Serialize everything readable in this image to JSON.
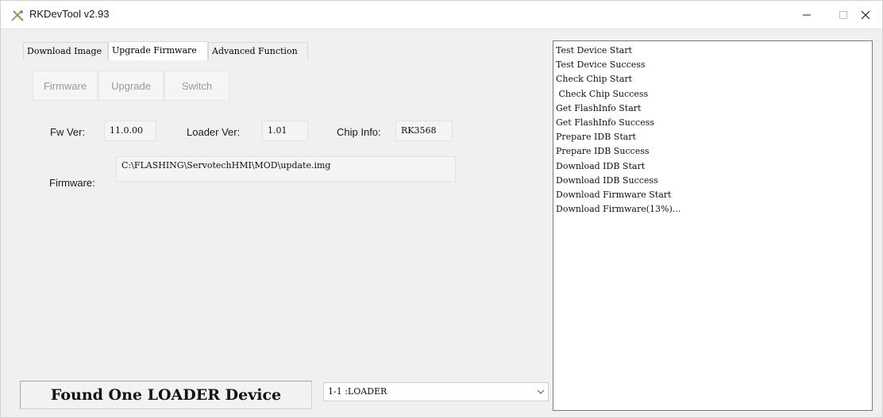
{
  "window": {
    "title": "RKDevTool v2.93",
    "icon": "rkdevtool-icon"
  },
  "controls": {
    "minimize": "minimize-icon",
    "maximize": "maximize-icon",
    "close": "close-icon"
  },
  "tabs": [
    {
      "label": "Download Image",
      "active": false
    },
    {
      "label": "Upgrade Firmware",
      "active": true
    },
    {
      "label": "Advanced Function",
      "active": false
    }
  ],
  "buttons": {
    "firmware": "Firmware",
    "upgrade": "Upgrade",
    "switch": "Switch"
  },
  "info": {
    "fw_ver_label": "Fw Ver:",
    "fw_ver_value": "11.0.00",
    "loader_ver_label": "Loader Ver:",
    "loader_ver_value": "1.01",
    "chip_info_label": "Chip Info:",
    "chip_info_value": "RK3568",
    "firmware_label": "Firmware:",
    "firmware_path": "C:\\FLASHING\\ServotechHMI\\MOD\\update.img"
  },
  "status": {
    "message": "Found One LOADER Device",
    "device_selected": "1-1 :LOADER"
  },
  "log": [
    "Test Device Start",
    "Test Device Success",
    "Check Chip Start",
    " Check Chip Success",
    "Get FlashInfo Start",
    "Get FlashInfo Success",
    "Prepare IDB Start",
    "Prepare IDB Success",
    "Download IDB Start",
    "Download IDB Success",
    "Download Firmware Start",
    "Download Firmware(13%)..."
  ],
  "colors": {
    "window_bg": "#f0f0f0",
    "titlebar_bg": "#ffffff",
    "disabled_text": "#9a9a9a"
  }
}
